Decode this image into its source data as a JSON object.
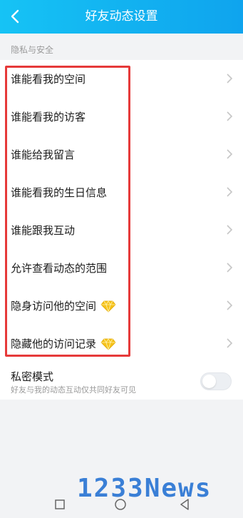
{
  "header": {
    "title": "好友动态设置"
  },
  "section": {
    "label": "隐私与安全"
  },
  "list": {
    "items": [
      {
        "label": "谁能看我的空间",
        "vip": false
      },
      {
        "label": "谁能看我的访客",
        "vip": false
      },
      {
        "label": "谁能给我留言",
        "vip": false
      },
      {
        "label": "谁能看我的生日信息",
        "vip": false
      },
      {
        "label": "谁能跟我互动",
        "vip": false
      },
      {
        "label": "允许查看动态的范围",
        "vip": false
      },
      {
        "label": "隐身访问他的空间",
        "vip": true
      },
      {
        "label": "隐藏他的访问记录",
        "vip": true
      }
    ]
  },
  "private_mode": {
    "title": "私密模式",
    "subtitle": "好友与我的动态互动仅共同好友可见",
    "enabled": false
  },
  "watermark": {
    "text": "1233News"
  },
  "colors": {
    "header_start": "#16c3f5",
    "header_end": "#0fa4ee",
    "highlight": "#e63a3a",
    "gem": "#f6c21a"
  },
  "icons": {
    "back": "chevron-left-icon",
    "row_arrow": "chevron-right-icon",
    "vip": "diamond-icon",
    "nav": [
      "square-icon",
      "circle-icon",
      "triangle-back-icon"
    ]
  }
}
